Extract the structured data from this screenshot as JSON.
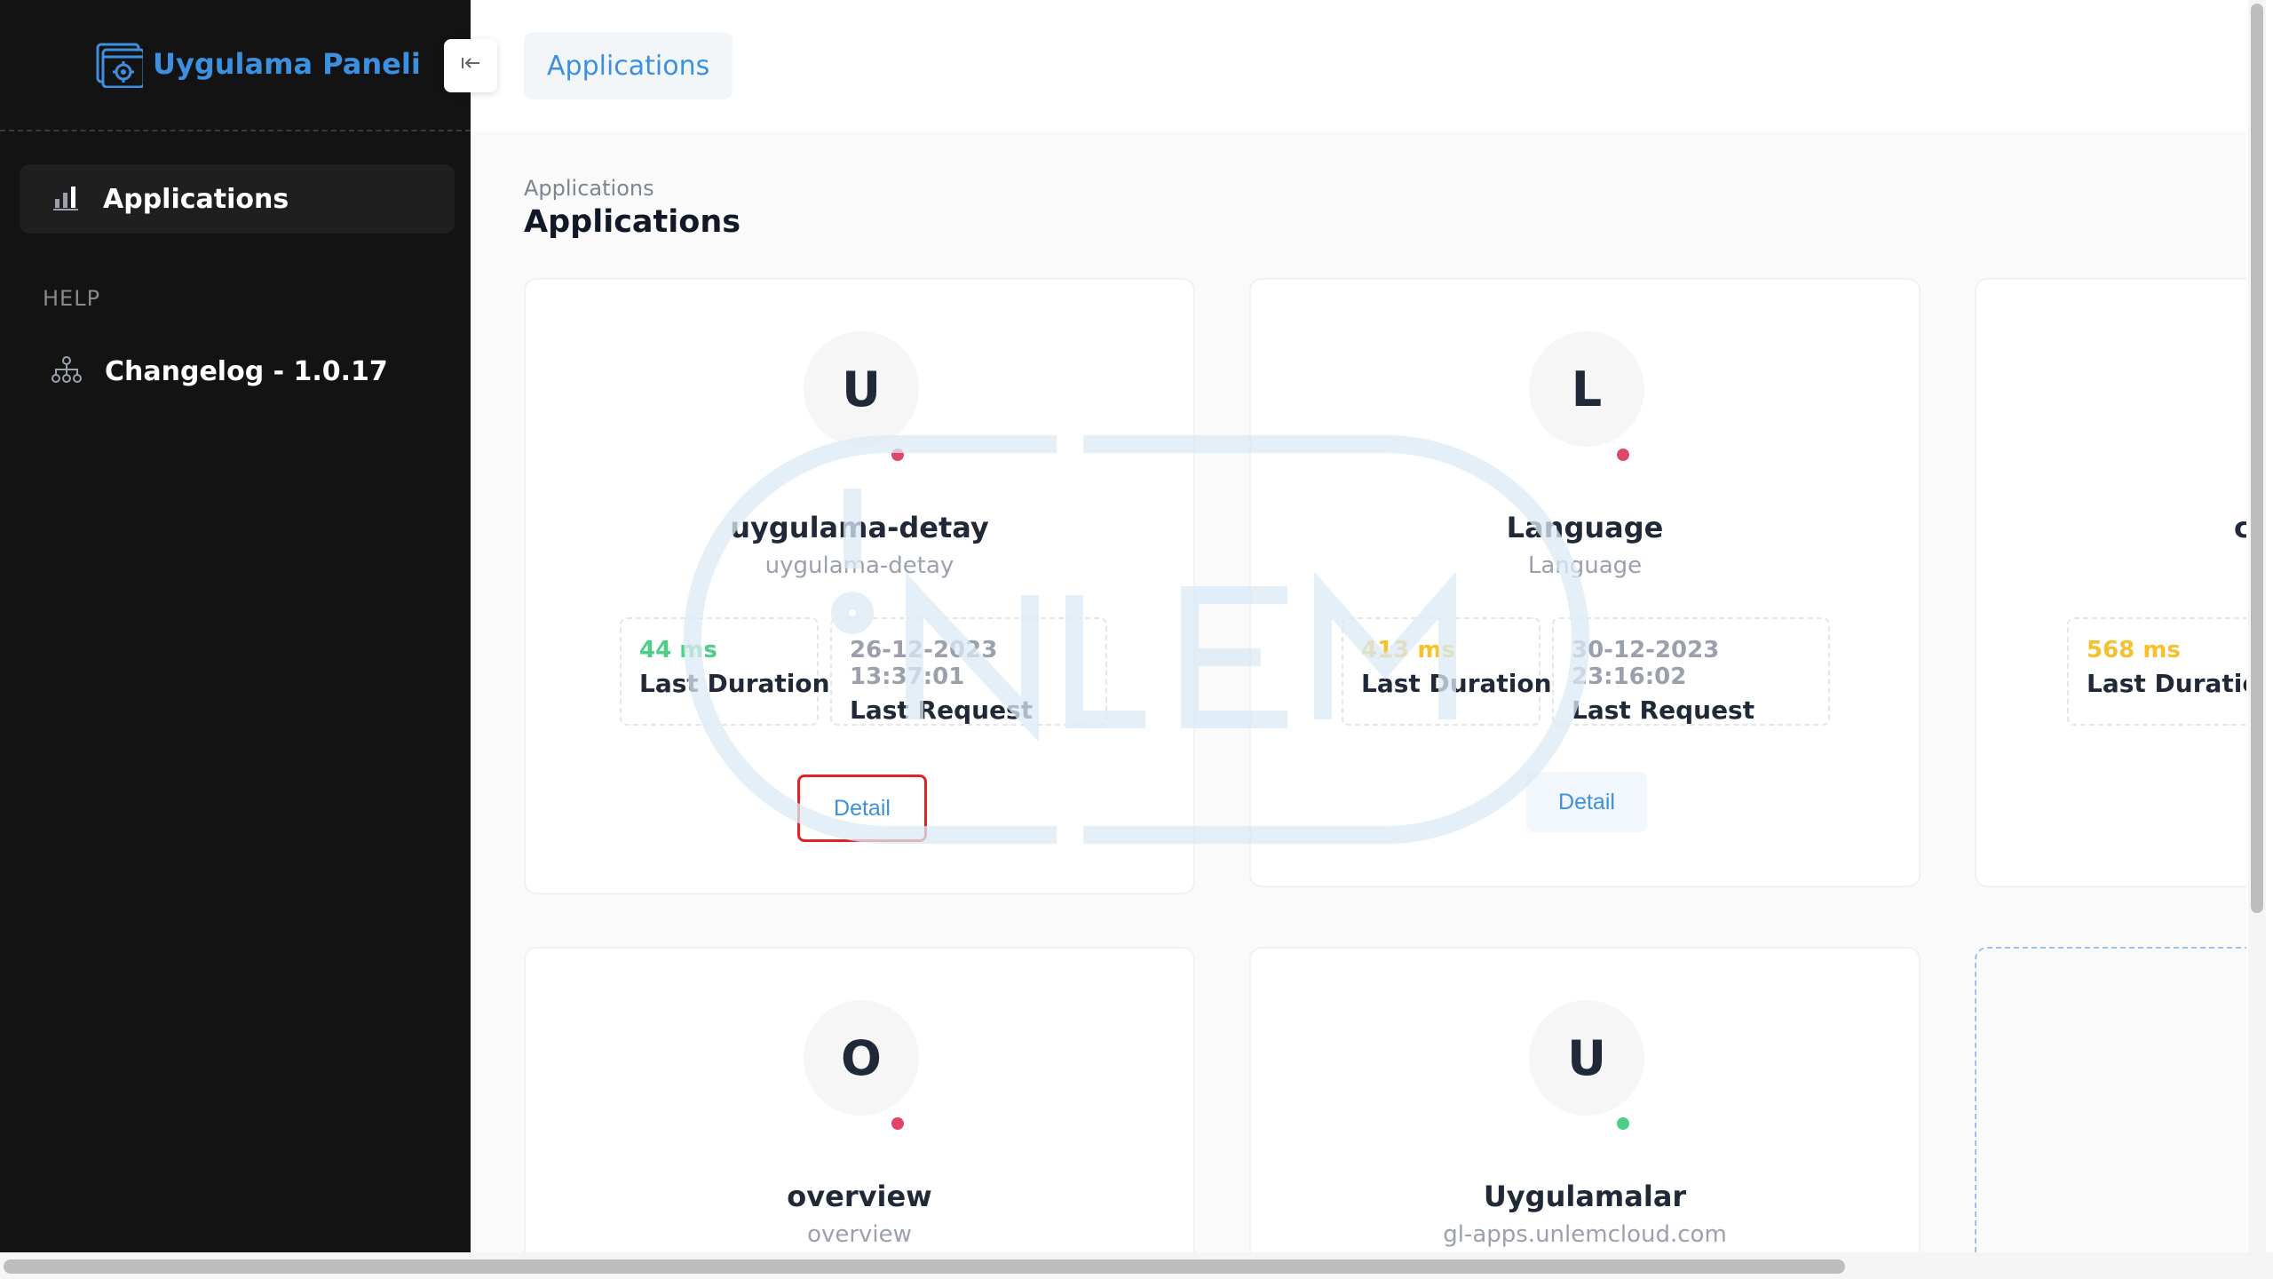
{
  "brand": {
    "name": "Uygulama Paneli"
  },
  "sidebar": {
    "active_item": {
      "label": "Applications",
      "icon": "bar-chart-icon"
    },
    "section_title": "HELP",
    "help_item": {
      "label": "Changelog - 1.0.17",
      "icon": "sitemap-icon"
    }
  },
  "header": {
    "tab_label": "Applications"
  },
  "page": {
    "breadcrumb": "Applications",
    "title": "Applications"
  },
  "common": {
    "duration_label": "Last Duration",
    "request_label": "Last Request",
    "detail_label": "Detail"
  },
  "cards": [
    {
      "initial": "U",
      "name": "uygulama-detay",
      "subtitle": "uygulama-detay",
      "status": "red",
      "duration": "44 ms",
      "last_request": "26-12-2023 13:37:01"
    },
    {
      "initial": "L",
      "name": "Language",
      "subtitle": "Language",
      "status": "red",
      "duration": "413 ms",
      "last_request": "30-12-2023 23:16:02"
    },
    {
      "initial": "",
      "name": "c",
      "subtitle": "",
      "status": "",
      "duration": "568 ms",
      "last_request": ""
    },
    {
      "initial": "O",
      "name": "overview",
      "subtitle": "overview",
      "status": "red"
    },
    {
      "initial": "U",
      "name": "Uygulamalar",
      "subtitle": "gl-apps.unlemcloud.com",
      "status": "green"
    }
  ],
  "colors": {
    "accent": "#3d8fe0",
    "sidebar_bg": "#131313",
    "status_red": "#e0466b",
    "status_green": "#4ccf84",
    "duration_green": "#4ccf84",
    "duration_yellow": "#f5c12d"
  }
}
